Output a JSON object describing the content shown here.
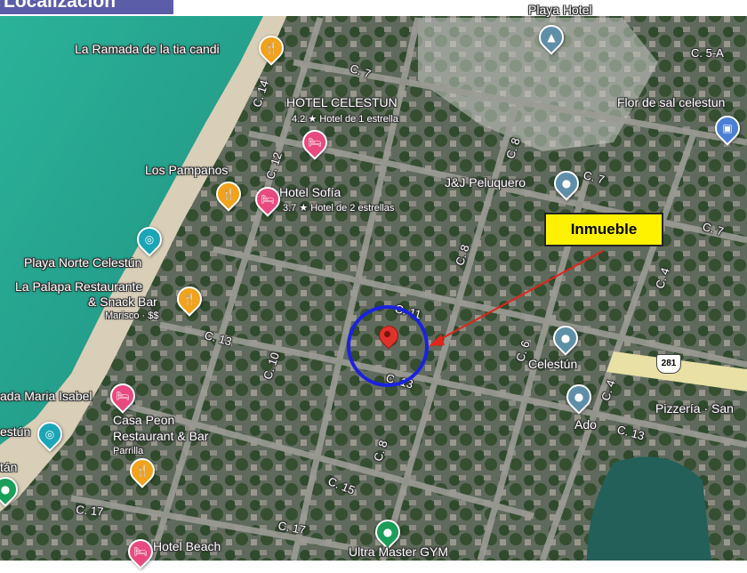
{
  "header": {
    "title": "Localización"
  },
  "callout": {
    "label": "Inmueble"
  },
  "colors": {
    "sea": "#2aa893",
    "land": "#6d7268",
    "callout": "#fff200",
    "circle": "#1a22e0",
    "arrow": "#e2241b",
    "marker": "#e0322b"
  },
  "places": {
    "ramada": "La Ramada de la tia candi",
    "hotel_celestun": "HOTEL CELESTUN",
    "hotel_celestun_sub": "4.2 ★ Hotel de 1 estrella",
    "pampanos": "Los Pampanos",
    "hotel_sofia": "Hotel Sofía",
    "hotel_sofia_sub": "3.7 ★ Hotel de 2 estrellas",
    "peluquero": "J&J Peluquero",
    "playa_norte": "Playa Norte Celestún",
    "palapa_line1": "La Palapa Restaurante",
    "palapa_line2": "& Snack Bar",
    "palapa_sub": "Marisco · $$",
    "maria_isabel": "ada Maria Isabel",
    "estun": "estún",
    "casa_peon_line1": "Casa Peon",
    "casa_peon_line2": "Restaurant & Bar",
    "casa_peon_sub": "Parrilla",
    "celestun": "Celestún",
    "ado": "Ado",
    "pizzeria": "Pizzería · San",
    "flor_de_sal": "Flor de sal celestun",
    "hotel_beach": "Hotel Beach",
    "ultra_master": "Ultra Master GYM",
    "tan": "tán",
    "top_place": "Playa Hotel"
  },
  "streets": {
    "c5a": "C. 5-A",
    "c7a": "C. 7",
    "c7b": "C. 7",
    "c7c": "C. 7",
    "c8a": "C. 8",
    "c8b": "C. 8",
    "c8c": "C. 8",
    "c14": "C. 14",
    "c12": "C. 12",
    "c11": "C. 11",
    "c13a": "C. 13",
    "c13b": "C. 13",
    "c13c": "C. 13",
    "c10": "C. 10",
    "c6": "C. 6",
    "c4a": "C. 4",
    "c4b": "C. 4",
    "c15": "C. 15",
    "c17a": "C. 17",
    "c17b": "C. 17"
  },
  "highway": "281"
}
